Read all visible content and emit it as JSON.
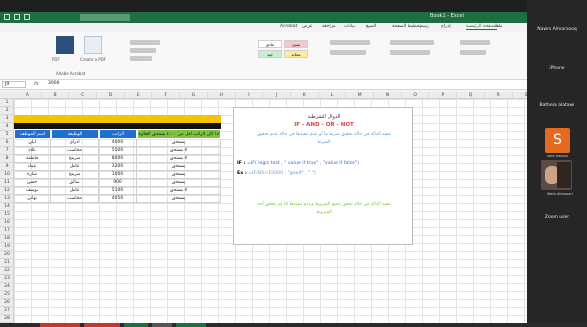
{
  "window": {
    "title": "Book1 - Excel",
    "ribbon_tabs": [
      "ملف",
      "الصفحة الرئيسية",
      "إدراج",
      "رسم",
      "تخطيط الصفحة",
      "الصيغ",
      "بيانات",
      "مراجعة",
      "عرض",
      "Acrobat"
    ],
    "active_tab_index": 1
  },
  "ribbon": {
    "group_labels": [
      "PDF",
      "Create a PDF",
      "Adobe Acrobat",
      "تنسيق شرطي",
      "تنسيق كجدول",
      "أنماط الخلايا"
    ],
    "styles": [
      {
        "label": "عادي",
        "bg": "#ffffff"
      },
      {
        "label": "سيئ",
        "bg": "#f4c7ce"
      },
      {
        "label": "جيد",
        "bg": "#c6efce"
      },
      {
        "label": "محايد",
        "bg": "#ffeb9c"
      }
    ]
  },
  "formula_bar": {
    "name_box": "J9",
    "fx": "fx",
    "formula": "3000"
  },
  "grid": {
    "columns": [
      "A",
      "B",
      "C",
      "D",
      "E",
      "F",
      "G",
      "H",
      "I",
      "J",
      "K",
      "L",
      "M",
      "N",
      "O",
      "P",
      "Q",
      "R",
      "S"
    ],
    "rows": [
      "1",
      "2",
      "3",
      "4",
      "5",
      "6",
      "7",
      "8",
      "9",
      "10",
      "11",
      "12",
      "13",
      "14",
      "15",
      "16",
      "17",
      "18",
      "19",
      "20",
      "21",
      "22",
      "23",
      "24",
      "25",
      "26",
      "27",
      "28"
    ]
  },
  "table": {
    "headers": [
      "اسم الموظف",
      "الوظيفة",
      "الراتب",
      "اذا كان الراتب اقل من ٤٠٠٠ يستحق العلاوة"
    ],
    "rows": [
      [
        "ايلي",
        "ادراي",
        "4000",
        "يستحق"
      ],
      [
        "علاء",
        "محاسب",
        "5500",
        "لا يستحق"
      ],
      [
        "فاطمة",
        "مبرمج",
        "8000",
        "لا يستحق"
      ],
      [
        "عماد",
        "عامل",
        "3200",
        "يستحق"
      ],
      [
        "سارة",
        "مبرمج",
        "1000",
        "يستحق"
      ],
      [
        "حسن",
        "سائق",
        "900",
        "يستحق"
      ],
      [
        "يوسف",
        "عامل",
        "5100",
        "لا يستحق"
      ],
      [
        "تهاني",
        "محاسب",
        "4050",
        "يستحق"
      ]
    ]
  },
  "explanation": {
    "title": "الدوال الشرطية",
    "subtitle": "IF - AND - OR - NOT",
    "desc_line1": "تنفيذ الدالة في حالة تحقيق شرط ما أو عدم تنفيذها في حالة عدم تحقيق",
    "desc_line2": "الشرط",
    "syntax_label": "IF :",
    "syntax": "=IF( logic test , \" value if true\" , \"value if false\")",
    "example_label": "Ex :",
    "example": "=IF(B5>15000 , \"good\" , \" \")",
    "and_line1": "تنفيذ الدالة في حالة تحقق جميع الشروط وعدم تنفيذها اذا لم تتحقق أحد",
    "and_line2": "الشروط"
  },
  "participants": {
    "items": [
      {
        "name": "Nawrs Almarzooq"
      },
      {
        "name": "iPhone"
      },
      {
        "name": "Batheia alatawi"
      },
      {
        "name": "Zoom user"
      }
    ],
    "speaker_initial": "S",
    "speaker_caption": "sara hassan",
    "video_caption": "Wafa Aldossari"
  },
  "colors": {
    "excel_green": "#1e6e42",
    "header_blue": "#1f6fd1",
    "header_green": "#7fc241",
    "yellow": "#f5c400",
    "speaker_orange": "#e36a1e",
    "if_red": "#d2473f"
  }
}
